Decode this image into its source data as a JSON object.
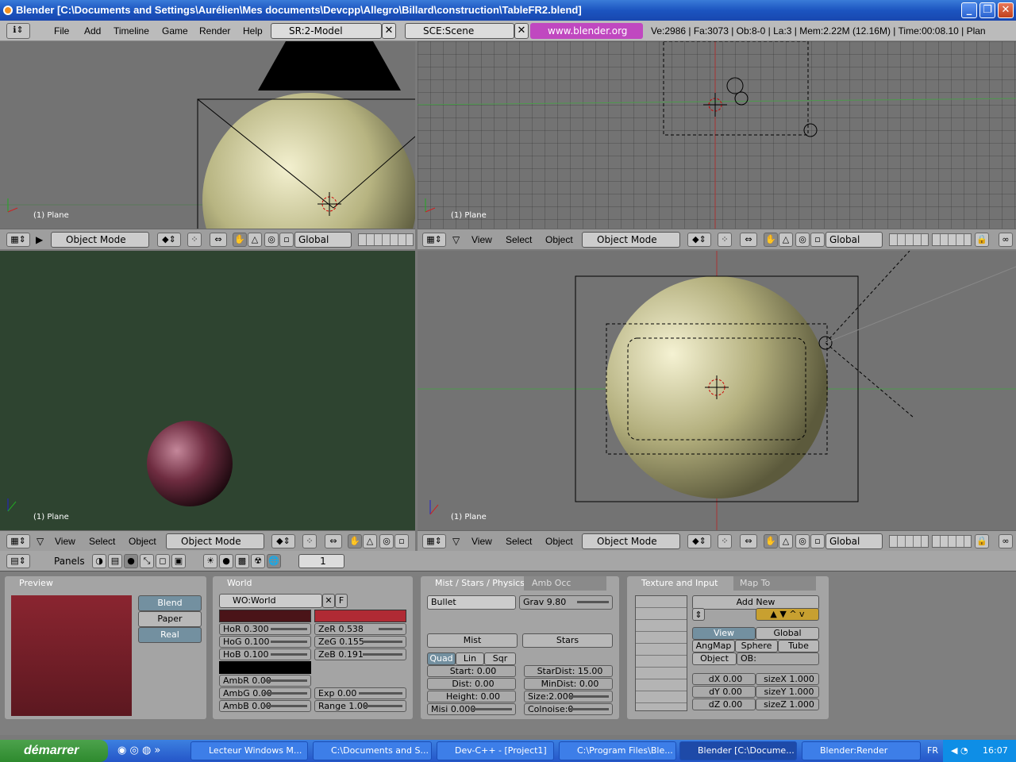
{
  "title": "Blender [C:\\Documents and Settings\\Aurélien\\Mes documents\\Devcpp\\Allegro\\Billard\\construction\\TableFR2.blend]",
  "window_buttons": {
    "min": "_",
    "max": "❐",
    "close": "✕"
  },
  "menu": {
    "items": [
      "File",
      "Add",
      "Timeline",
      "Game",
      "Render",
      "Help"
    ]
  },
  "screen": "SR:2-Model",
  "scene": "SCE:Scene",
  "web": "www.blender.org 246",
  "status": "Ve:2986 | Fa:3073 | Ob:8-0 | La:3  | Mem:2.22M (12.16M)  | Time:00:08.10 | Plan",
  "viewports": {
    "tl": {
      "label": "(1) Plane"
    },
    "tr": {
      "label": "(1) Plane"
    },
    "bl": {
      "label": "(1) Plane"
    },
    "br": {
      "label": "(1) Plane"
    }
  },
  "vp_header": {
    "view": "View",
    "select": "Select",
    "object": "Object",
    "mode": "Object Mode",
    "orient": "Global"
  },
  "buttons": {
    "panels_label": "Panels",
    "frame": "1",
    "preview": {
      "title": "Preview",
      "blend": "Blend",
      "paper": "Paper",
      "real": "Real",
      "color": "#7a1e25"
    },
    "world": {
      "title": "World",
      "name": "WO:World",
      "f": "F",
      "hor": "HoR 0.300",
      "hog": "HoG 0.100",
      "hob": "HoB 0.100",
      "zer": "ZeR 0.538",
      "zeg": "ZeG 0.155",
      "zeb": "ZeB 0.191",
      "ambr": "AmbR 0.00",
      "ambg": "AmbG 0.00",
      "ambb": "AmbB 0.00",
      "exp": "Exp 0.00",
      "range": "Range 1.00",
      "horizon_color": "#4a1418",
      "zenith_color": "#b02a34"
    },
    "mist": {
      "tab1": "Mist / Stars / Physics",
      "tab2": "Amb Occ",
      "engine": "Bullet",
      "grav": "Grav 9.80",
      "mist": "Mist",
      "stars": "Stars",
      "quad": "Quad",
      "lin": "Lin",
      "sqr": "Sqr",
      "start": "Start: 0.00",
      "dist": "Dist: 0.00",
      "height": "Height: 0.00",
      "misi": "Misi 0.000",
      "stardist": "StarDist: 15.00",
      "mindist": "MinDist: 0.00",
      "size": "Size:2.000",
      "colnoise": "Colnoise:0"
    },
    "texture": {
      "tab1": "Texture and Input",
      "tab2": "Map To",
      "addnew": "Add New",
      "view": "View",
      "global": "Global",
      "angmap": "AngMap",
      "sphere": "Sphere",
      "tube": "Tube",
      "object": "Object",
      "ob": "OB:",
      "dx": "dX 0.00",
      "dy": "dY 0.00",
      "dz": "dZ 0.00",
      "sx": "sizeX 1.000",
      "sy": "sizeY 1.000",
      "sz": "sizeZ 1.000"
    }
  },
  "taskbar": {
    "start": "démarrer",
    "items": [
      "Lecteur Windows M...",
      "C:\\Documents and S...",
      "Dev-C++ - [Project1]",
      "C:\\Program Files\\Ble...",
      "Blender [C:\\Docume...",
      "Blender:Render"
    ],
    "lang": "FR",
    "clock": "16:07"
  }
}
